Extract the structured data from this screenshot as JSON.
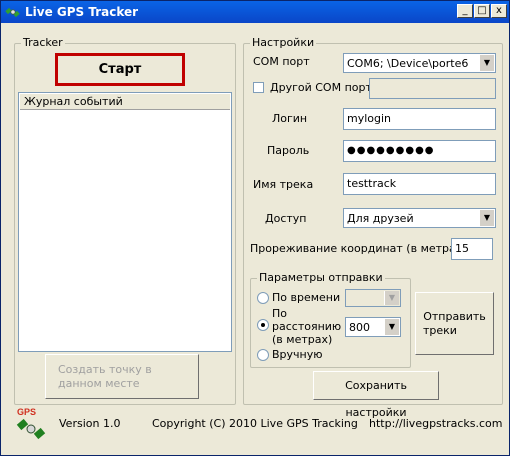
{
  "window": {
    "title": "Live GPS Tracker",
    "controls": [
      "_",
      "□",
      "x"
    ]
  },
  "tracker": {
    "group_title": "Tracker",
    "start_button": "Старт",
    "log_header": "Журнал событий",
    "create_point_button": "Создать точку в данном месте"
  },
  "settings": {
    "group_title": "Настройки",
    "com_port_label": "COM порт",
    "com_port_value": "COM6; \\Device\\porte6",
    "other_com_label": "Другой COM порт",
    "other_com_value": "",
    "login_label": "Логин",
    "login_value": "mylogin",
    "password_label": "Пароль",
    "password_value": "●●●●●●●●●",
    "track_name_label": "Имя трека",
    "track_name_value": "testtrack",
    "access_label": "Доступ",
    "access_value": "Для друзей",
    "thinning_label": "Прореживание координат (в метрах)",
    "thinning_value": "15",
    "send_params_title": "Параметры отправки",
    "by_time_label": "По времени",
    "by_time_value": "",
    "by_distance_label_1": "По",
    "by_distance_label_2": "расстоянию",
    "by_distance_label_3": "(в метрах)",
    "by_distance_value": "800",
    "manual_label": "Вручную",
    "send_tracks_line1": "Отправить",
    "send_tracks_line2": "треки",
    "save_button": "Сохранить настройки"
  },
  "footer": {
    "logo_text": "GPS",
    "version": "Version 1.0",
    "copyright": "Copyright (C) 2010 Live GPS Tracking",
    "url": "http://livegpstracks.com"
  },
  "colors": {
    "titlebar": "#0a46c8",
    "start_border": "#c00000",
    "disabled_text": "#a0a0a0",
    "logo_red": "#d03020",
    "logo_green": "#208020"
  }
}
